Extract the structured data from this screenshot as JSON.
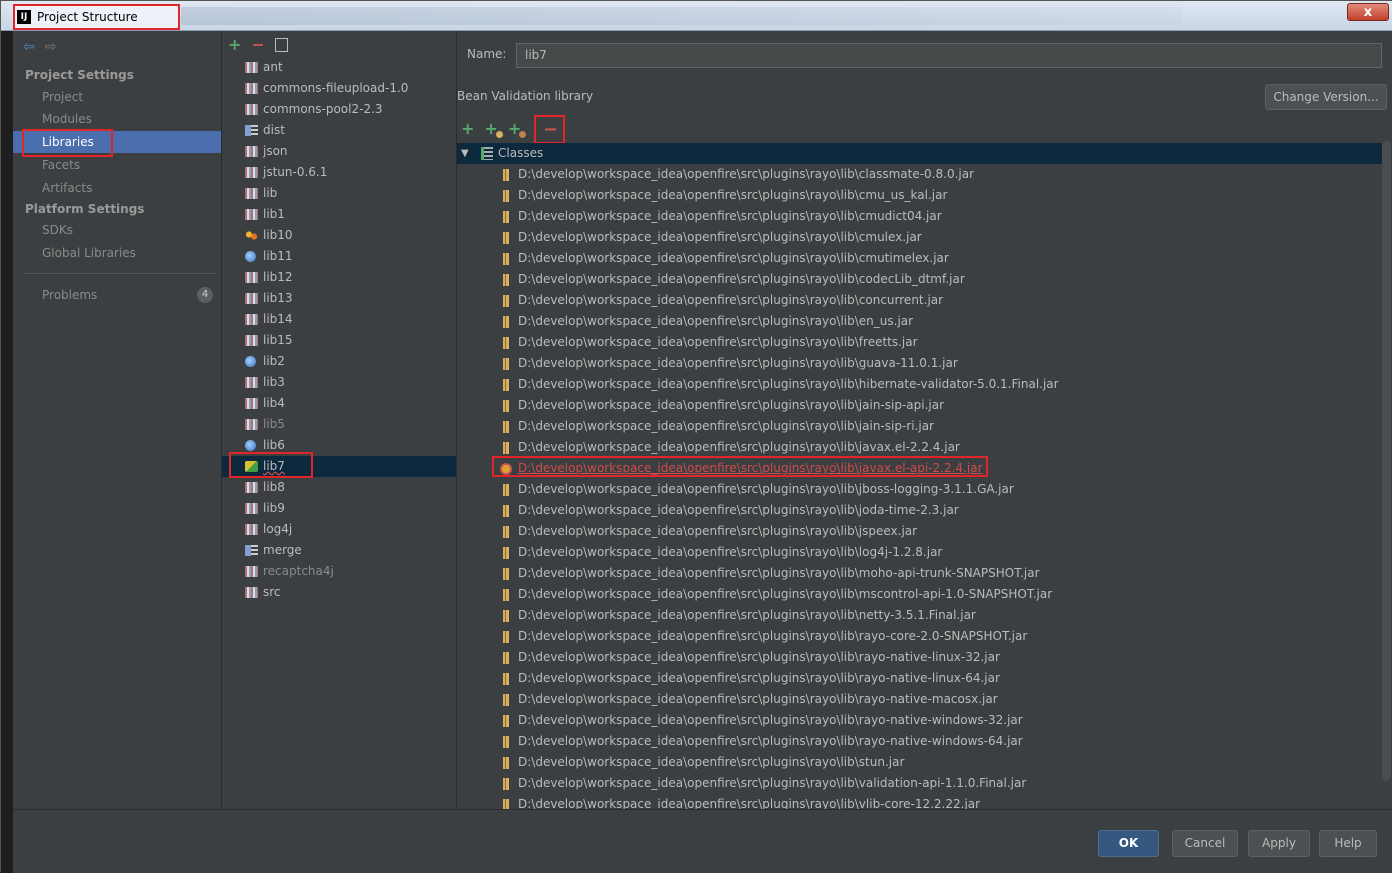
{
  "window": {
    "title": "Project Structure",
    "app_icon": "IJ",
    "close": "x"
  },
  "sidebar": {
    "project_settings_heading": "Project Settings",
    "platform_settings_heading": "Platform Settings",
    "items": [
      {
        "label": "Project"
      },
      {
        "label": "Modules"
      },
      {
        "label": "Libraries",
        "selected": true
      },
      {
        "label": "Facets"
      },
      {
        "label": "Artifacts"
      },
      {
        "label": "SDKs"
      },
      {
        "label": "Global Libraries"
      }
    ],
    "problems": {
      "label": "Problems",
      "count": "4"
    }
  },
  "libraries": [
    {
      "name": "ant",
      "icon": "jar-icon"
    },
    {
      "name": "commons-fileupload-1.0",
      "icon": "jar-icon"
    },
    {
      "name": "commons-pool2-2.3",
      "icon": "jar-icon"
    },
    {
      "name": "dist",
      "icon": "module-icon"
    },
    {
      "name": "json",
      "icon": "jar-icon"
    },
    {
      "name": "jstun-0.6.1",
      "icon": "jar-icon"
    },
    {
      "name": "lib",
      "icon": "jar-icon"
    },
    {
      "name": "lib1",
      "icon": "jar-icon"
    },
    {
      "name": "lib10",
      "icon": "multi-icon"
    },
    {
      "name": "lib11",
      "icon": "globe-icon"
    },
    {
      "name": "lib12",
      "icon": "jar-icon"
    },
    {
      "name": "lib13",
      "icon": "jar-icon"
    },
    {
      "name": "lib14",
      "icon": "jar-icon"
    },
    {
      "name": "lib15",
      "icon": "jar-icon"
    },
    {
      "name": "lib2",
      "icon": "globe-icon"
    },
    {
      "name": "lib3",
      "icon": "jar-icon"
    },
    {
      "name": "lib4",
      "icon": "jar-icon"
    },
    {
      "name": "lib5",
      "icon": "jar-icon",
      "dim": true
    },
    {
      "name": "lib6",
      "icon": "globe-icon"
    },
    {
      "name": "lib7",
      "icon": "lib7-icon",
      "selected": true
    },
    {
      "name": "lib8",
      "icon": "jar-icon"
    },
    {
      "name": "lib9",
      "icon": "jar-icon"
    },
    {
      "name": "log4j",
      "icon": "jar-icon"
    },
    {
      "name": "merge",
      "icon": "module-icon"
    },
    {
      "name": "recaptcha4j",
      "icon": "jar-icon",
      "dim": true
    },
    {
      "name": "src",
      "icon": "jar-icon"
    }
  ],
  "detail": {
    "name_label": "Name:",
    "name_value": "lib7",
    "library_type": "Bean Validation library",
    "change_version": "Change Version...",
    "classes_label": "Classes",
    "entries": [
      "D:\\develop\\workspace_idea\\openfire\\src\\plugins\\rayo\\lib\\classmate-0.8.0.jar",
      "D:\\develop\\workspace_idea\\openfire\\src\\plugins\\rayo\\lib\\cmu_us_kal.jar",
      "D:\\develop\\workspace_idea\\openfire\\src\\plugins\\rayo\\lib\\cmudict04.jar",
      "D:\\develop\\workspace_idea\\openfire\\src\\plugins\\rayo\\lib\\cmulex.jar",
      "D:\\develop\\workspace_idea\\openfire\\src\\plugins\\rayo\\lib\\cmutimelex.jar",
      "D:\\develop\\workspace_idea\\openfire\\src\\plugins\\rayo\\lib\\codecLib_dtmf.jar",
      "D:\\develop\\workspace_idea\\openfire\\src\\plugins\\rayo\\lib\\concurrent.jar",
      "D:\\develop\\workspace_idea\\openfire\\src\\plugins\\rayo\\lib\\en_us.jar",
      "D:\\develop\\workspace_idea\\openfire\\src\\plugins\\rayo\\lib\\freetts.jar",
      "D:\\develop\\workspace_idea\\openfire\\src\\plugins\\rayo\\lib\\guava-11.0.1.jar",
      "D:\\develop\\workspace_idea\\openfire\\src\\plugins\\rayo\\lib\\hibernate-validator-5.0.1.Final.jar",
      "D:\\develop\\workspace_idea\\openfire\\src\\plugins\\rayo\\lib\\jain-sip-api.jar",
      "D:\\develop\\workspace_idea\\openfire\\src\\plugins\\rayo\\lib\\jain-sip-ri.jar",
      "D:\\develop\\workspace_idea\\openfire\\src\\plugins\\rayo\\lib\\javax.el-2.2.4.jar",
      "D:\\develop\\workspace_idea\\openfire\\src\\plugins\\rayo\\lib\\javax.el-api-2.2.4.jar",
      "D:\\develop\\workspace_idea\\openfire\\src\\plugins\\rayo\\lib\\jboss-logging-3.1.1.GA.jar",
      "D:\\develop\\workspace_idea\\openfire\\src\\plugins\\rayo\\lib\\joda-time-2.3.jar",
      "D:\\develop\\workspace_idea\\openfire\\src\\plugins\\rayo\\lib\\jspeex.jar",
      "D:\\develop\\workspace_idea\\openfire\\src\\plugins\\rayo\\lib\\log4j-1.2.8.jar",
      "D:\\develop\\workspace_idea\\openfire\\src\\plugins\\rayo\\lib\\moho-api-trunk-SNAPSHOT.jar",
      "D:\\develop\\workspace_idea\\openfire\\src\\plugins\\rayo\\lib\\mscontrol-api-1.0-SNAPSHOT.jar",
      "D:\\develop\\workspace_idea\\openfire\\src\\plugins\\rayo\\lib\\netty-3.5.1.Final.jar",
      "D:\\develop\\workspace_idea\\openfire\\src\\plugins\\rayo\\lib\\rayo-core-2.0-SNAPSHOT.jar",
      "D:\\develop\\workspace_idea\\openfire\\src\\plugins\\rayo\\lib\\rayo-native-linux-32.jar",
      "D:\\develop\\workspace_idea\\openfire\\src\\plugins\\rayo\\lib\\rayo-native-linux-64.jar",
      "D:\\develop\\workspace_idea\\openfire\\src\\plugins\\rayo\\lib\\rayo-native-macosx.jar",
      "D:\\develop\\workspace_idea\\openfire\\src\\plugins\\rayo\\lib\\rayo-native-windows-32.jar",
      "D:\\develop\\workspace_idea\\openfire\\src\\plugins\\rayo\\lib\\rayo-native-windows-64.jar",
      "D:\\develop\\workspace_idea\\openfire\\src\\plugins\\rayo\\lib\\stun.jar",
      "D:\\develop\\workspace_idea\\openfire\\src\\plugins\\rayo\\lib\\validation-api-1.1.0.Final.jar",
      "D:\\develop\\workspace_idea\\openfire\\src\\plugins\\rayo\\lib\\vlib-core-12.2.22.jar"
    ],
    "invalid_entry": "D:\\develop\\workspace_idea\\openfire\\src\\plugins\\rayo\\lib\\javax.el-api-2.2.4.jar"
  },
  "footer": {
    "ok": "OK",
    "cancel": "Cancel",
    "apply": "Apply",
    "help": "Help"
  },
  "colors": {
    "accent": "#4b6eaf",
    "selection": "#0d293e",
    "highlight": "#e0262a",
    "error_text": "#d04a4a"
  }
}
